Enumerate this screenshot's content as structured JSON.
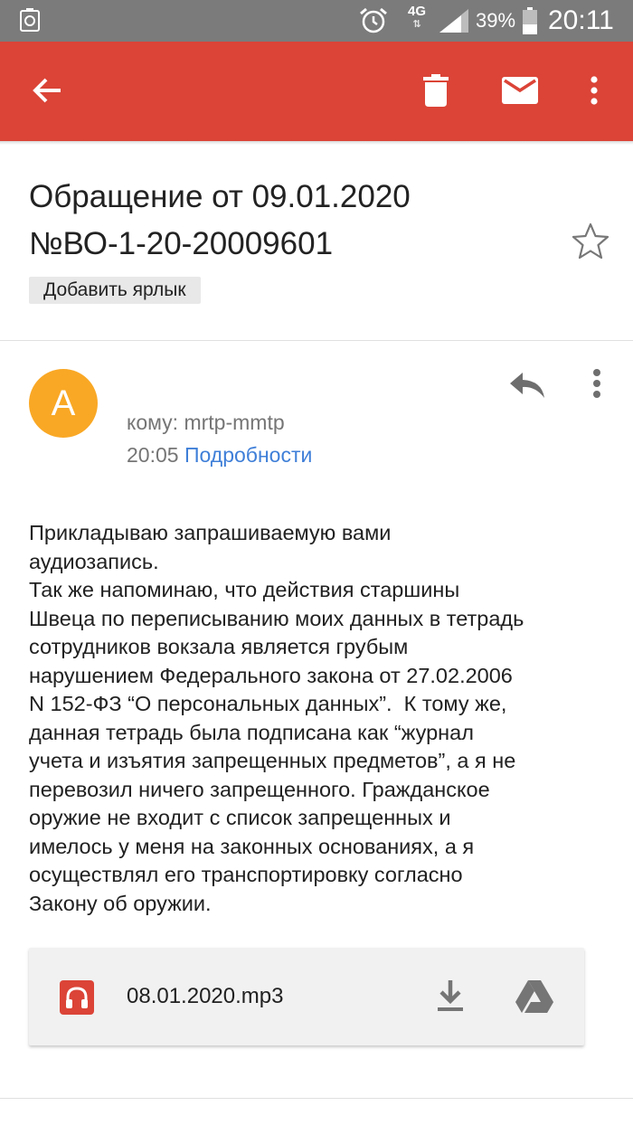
{
  "status_bar": {
    "network": "4G",
    "network_arrows": "⇅",
    "battery_percent": "39%",
    "time": "20:11"
  },
  "app_bar": {
    "color": "#db4437",
    "icons": [
      "back-arrow-icon",
      "delete-icon",
      "mail-icon",
      "more-vert-icon"
    ]
  },
  "email": {
    "subject_line1": "Обращение от 09.01.2020",
    "subject_line2": "№ВО-1-20-20009601",
    "label_button": "Добавить ярлык",
    "sender_initial": "A",
    "avatar_color": "#f9a825",
    "recipient": "кому: mrtp-mmtp",
    "time": "20:05",
    "details_link": "Подробности",
    "body": {
      "line1": "Прикладываю запрашиваемую вами",
      "line2": "аудиозапись.",
      "line3": "Так же напоминаю, что действия старшины",
      "line4": "Швеца по переписыванию моих данных в тетрадь",
      "line5": "сотрудников вокзала является грубым",
      "line6": "нарушением Федерального закона от 27.02.2006",
      "line7": "N 152-ФЗ “О персональных данных”.  К тому же,",
      "line8": "данная тетрадь была подписана как “журнал",
      "line9": "учета и изъятия запрещенных предметов”, а я не",
      "line10": "перевозил ничего запрещенного. Гражданское",
      "line11": "оружие не входит с список запрещенных и",
      "line12": "имелось у меня на законных основаниях, а я",
      "line13": "осуществлял его транспортировку согласно",
      "line14": "Закону об оружии."
    },
    "attachment": {
      "filename": "08.01.2020.mp3",
      "icon_color": "#db4437"
    }
  }
}
